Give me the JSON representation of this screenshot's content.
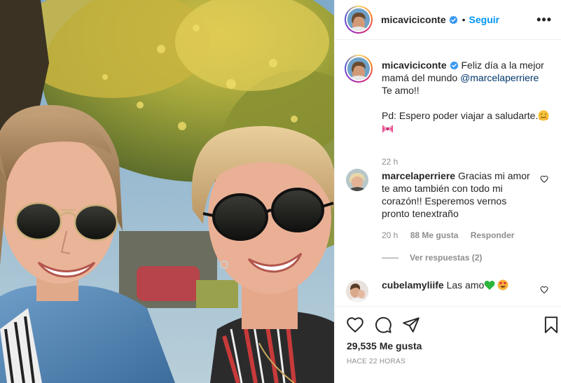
{
  "post": {
    "username": "micaviciconte",
    "follow_label": "Seguir",
    "dot": "•",
    "more_label": "•••"
  },
  "caption": {
    "username": "micaviciconte",
    "text_1": "Feliz día a la mejor mamá del mundo",
    "mention": "@marcelaperriere",
    "text_2": "Te amo!!",
    "text_3": "Pd: Espero poder viajar a saludarte.",
    "time": "22 h"
  },
  "comments": [
    {
      "username": "marcelaperriere",
      "text": "Gracias mi amor te amo también con todo mi corazón!! Esperemos vernos pronto tenextraño",
      "time": "20 h",
      "likes": "88 Me gusta",
      "reply_label": "Responder"
    },
    {
      "username": "cubelamyliife",
      "text": "Las amo"
    }
  ],
  "replies_label": "Ver respuestas (2)",
  "footer": {
    "likes": "29,535 Me gusta",
    "posted": "HACE 22 HORAS"
  },
  "icons": {
    "like": "heart-icon",
    "comment": "comment-icon",
    "share": "paper-plane-icon",
    "save": "bookmark-icon",
    "verified": "verified-badge-icon"
  },
  "colors": {
    "accent": "#0095f6",
    "mention": "#00376b",
    "muted": "#8e8e8e",
    "text": "#262626",
    "verified": "#3897f0"
  }
}
